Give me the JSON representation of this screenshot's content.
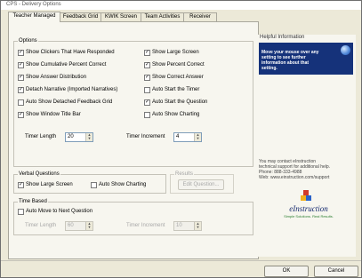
{
  "window": {
    "title": "CPS - Delivery Options"
  },
  "tabs": [
    {
      "label": "Teacher Managed"
    },
    {
      "label": "Feedback Grid"
    },
    {
      "label": "KWIK Screen"
    },
    {
      "label": "Team Activities"
    },
    {
      "label": "Receiver"
    }
  ],
  "options": {
    "group_label": "Options",
    "left": [
      {
        "label": "Show Clickers That Have Responded",
        "checked": true
      },
      {
        "label": "Show Cumulative Percent Correct",
        "checked": true
      },
      {
        "label": "Show Answer Distribution",
        "checked": true
      },
      {
        "label": "Detach Narrative (Imported Narratives)",
        "checked": true
      },
      {
        "label": "Auto Show Detached Feedback Grid",
        "checked": false
      },
      {
        "label": "Show Window Title Bar",
        "checked": true
      }
    ],
    "right": [
      {
        "label": "Show Large Screen",
        "checked": true
      },
      {
        "label": "Show Percent Correct",
        "checked": true
      },
      {
        "label": "Show Correct Answer",
        "checked": true
      },
      {
        "label": "Auto Start the Timer",
        "checked": false
      },
      {
        "label": "Auto Start the Question",
        "checked": true
      },
      {
        "label": "Auto Show Charting",
        "checked": false
      }
    ],
    "timer_length": {
      "label": "Timer Length",
      "value": "20"
    },
    "timer_increment": {
      "label": "Timer Increment",
      "value": "4"
    }
  },
  "verbal": {
    "group_label": "Verbal Questions",
    "show_large_screen": {
      "label": "Show Large Screen",
      "checked": true
    },
    "auto_show_charting": {
      "label": "Auto Show Charting",
      "checked": false
    }
  },
  "results": {
    "group_label": "Results",
    "button_label": "Edit Question..."
  },
  "time_based": {
    "group_label": "Time Based",
    "auto_move": {
      "label": "Auto Move to Next Question",
      "checked": false
    },
    "timer_length": {
      "label": "Timer Length",
      "value": "60"
    },
    "timer_increment": {
      "label": "Timer Increment",
      "value": "10"
    }
  },
  "help": {
    "title": "Helpful Information",
    "message": "Move your mouse over any setting to see further information about that setting.",
    "support_lines": [
      "You may contact eInstruction",
      "technical support for additional help.",
      "Phone: 888-333-4988",
      "Web: www.einstruction.com/support"
    ]
  },
  "logo": {
    "name": "eInstruction",
    "tagline": "Simple Solutions. Real Results."
  },
  "buttons": {
    "ok": "OK",
    "cancel": "Cancel"
  },
  "colors": {
    "help_box": "#15327a",
    "logo_text": "#14286e",
    "tagline": "#2a7e2f"
  }
}
